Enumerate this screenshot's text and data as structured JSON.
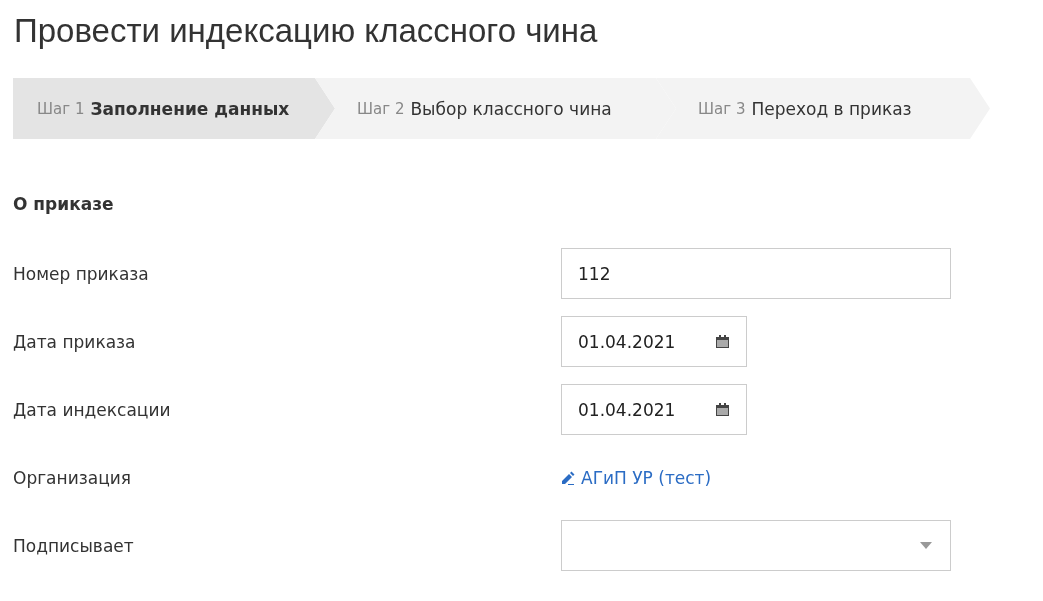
{
  "title": "Провести индексацию классного чина",
  "steps": [
    {
      "number": "Шаг 1",
      "label": "Заполнение данных",
      "selected": true
    },
    {
      "number": "Шаг 2",
      "label": "Выбор классного чина",
      "selected": false
    },
    {
      "number": "Шаг 3",
      "label": "Переход в приказ",
      "selected": false
    }
  ],
  "section": "О приказе",
  "fields": [
    {
      "label": "Номер приказа",
      "kind": "text",
      "value": "112"
    },
    {
      "label": "Дата приказа",
      "kind": "date",
      "value": "01.04.2021"
    },
    {
      "label": "Дата индексации",
      "kind": "date",
      "value": "01.04.2021"
    },
    {
      "label": "Организация",
      "kind": "link",
      "value": "АГиП УР (тест)"
    },
    {
      "label": "Подписывает",
      "kind": "select"
    }
  ]
}
